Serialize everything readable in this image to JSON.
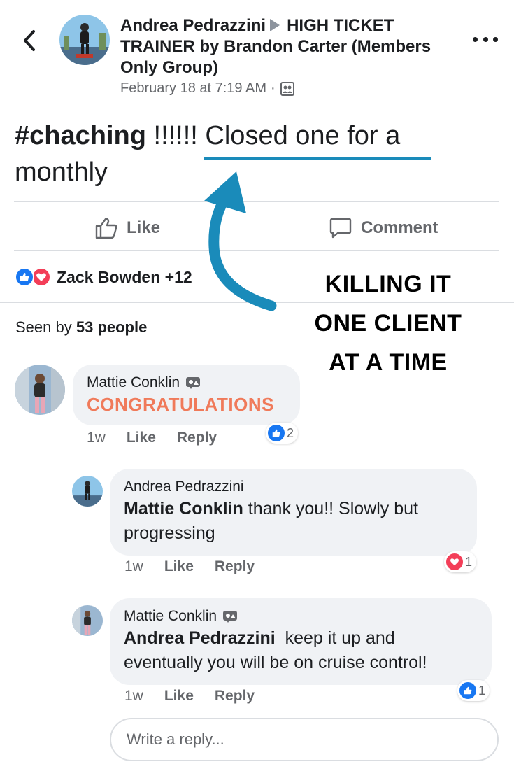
{
  "header": {
    "author": "Andrea Pedrazzini",
    "group": "HIGH TICKET TRAINER by Brandon Carter (Members Only Group)",
    "timestamp": "February 18 at 7:19 AM",
    "separator": "·"
  },
  "post": {
    "hashtag": "#chaching",
    "exclaim": " !!!!!! ",
    "text": "Closed one for a monthly"
  },
  "actions": {
    "like_label": "Like",
    "comment_label": "Comment"
  },
  "reactions": {
    "summary": "Zack Bowden +12"
  },
  "seen_by": {
    "prefix": "Seen by",
    "count": "53 people"
  },
  "overlay": {
    "line1": "KILLING IT",
    "line2": "ONE CLIENT",
    "line3": "AT A TIME"
  },
  "comments": [
    {
      "author": "Mattie Conklin",
      "text": "CONGRATULATIONS",
      "time": "1w",
      "like_label": "Like",
      "reply_label": "Reply",
      "reaction_type": "like",
      "reaction_count": "2"
    },
    {
      "author": "Andrea Pedrazzini",
      "mention": "Mattie Conklin",
      "text": " thank you!! Slowly but progressing",
      "time": "1w",
      "like_label": "Like",
      "reply_label": "Reply",
      "reaction_type": "love",
      "reaction_count": "1"
    },
    {
      "author": "Mattie Conklin",
      "mention": "Andrea Pedrazzini",
      "text": "  keep it up and eventually you will be on cruise control!",
      "time": "1w",
      "like_label": "Like",
      "reply_label": "Reply",
      "reaction_type": "like",
      "reaction_count": "1"
    }
  ],
  "reply_input": {
    "placeholder": "Write a reply..."
  },
  "colors": {
    "accent_blue": "#1877f2",
    "love_red": "#f33e58",
    "annotation_blue": "#1a8bba",
    "congrats_orange": "#f07a5a"
  }
}
